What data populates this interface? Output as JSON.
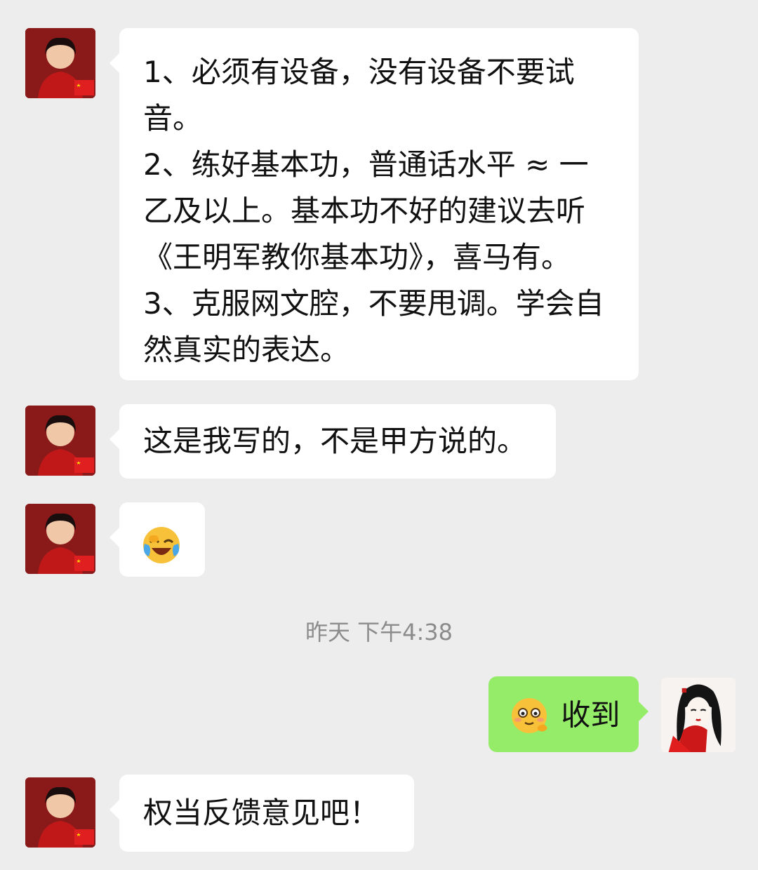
{
  "messages": [
    {
      "lines": [
        "1、必须有设备，没有设备不要试",
        "音。",
        "2、练好基本功，普通话水平 ≈ 一",
        "乙及以上。基本功不好的建议去听",
        "《王明军教你基本功》，喜马有。",
        "3、克服网文腔，不要甩调。学会自",
        "然真实的表达。"
      ]
    },
    {
      "text": "这是我写的，不是甲方说的。"
    },
    {
      "emoji": "crying-laughing-emoji"
    },
    {
      "text": "权当反馈意见吧！"
    }
  ],
  "timestamp": "昨天 下午4:38",
  "reply": {
    "emoji": "smiling-face-emoji",
    "text": "收到"
  }
}
